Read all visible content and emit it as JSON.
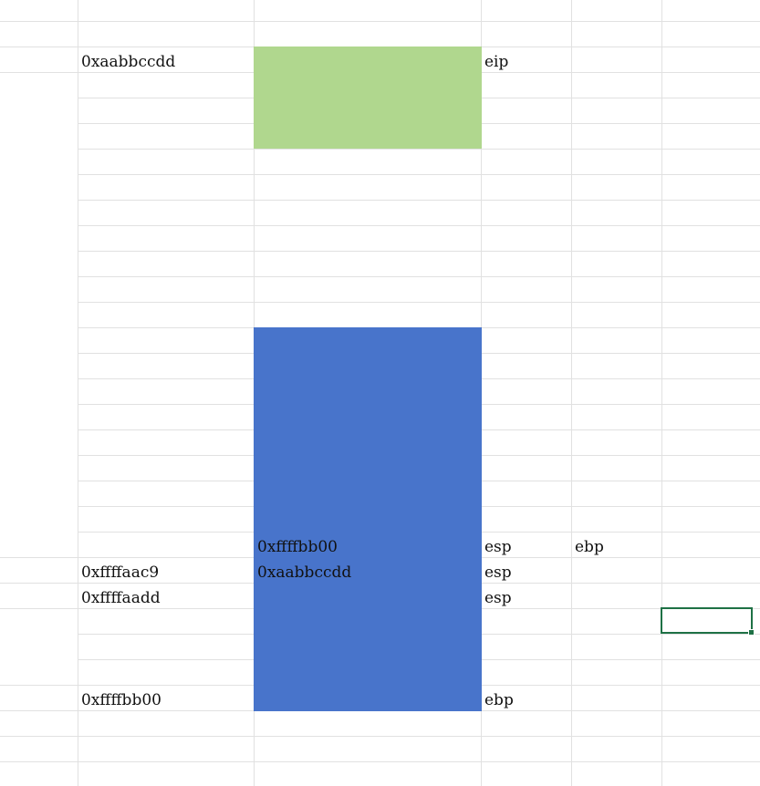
{
  "fill_colors": {
    "green_block": "#b0d78e",
    "blue_block": "#4874cb",
    "gridline": "#e1e1e1",
    "selection": "#1e7145"
  },
  "cells": {
    "a_row2": "0xaabbccdd",
    "c_row2": "eip",
    "b_row21": "0xffffbb00",
    "c_row21": "esp",
    "d_row21": "ebp",
    "a_row22": "0xffffaac9",
    "b_row22": "0xaabbccdd",
    "c_row22": "esp",
    "a_row23": "0xffffaadd",
    "c_row23": "esp",
    "a_row27": "0xffffbb00",
    "c_row27": "ebp"
  }
}
